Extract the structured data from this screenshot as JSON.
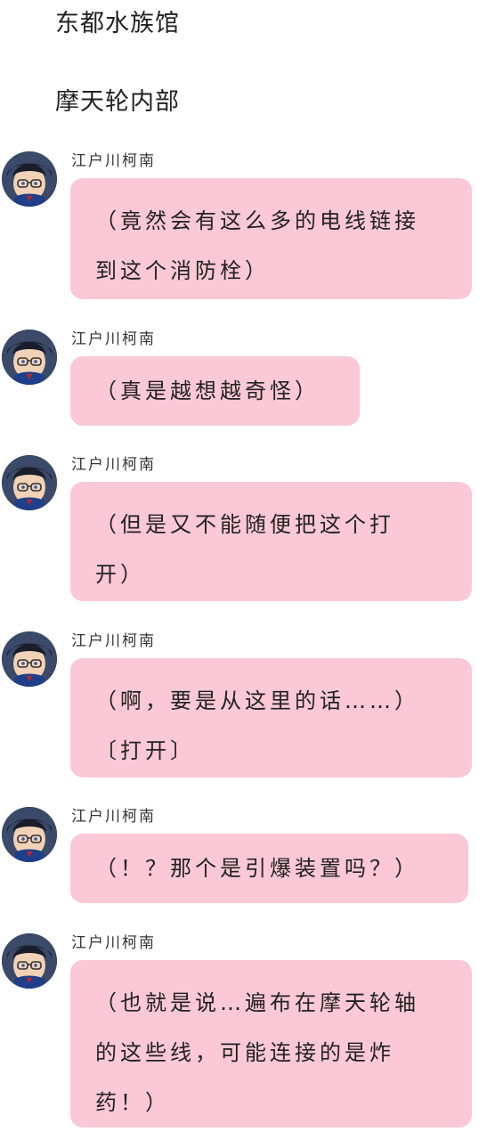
{
  "scene": {
    "location": "东都水族馆",
    "sublocation": "摩天轮内部"
  },
  "messages": [
    {
      "sender": "江户川柯南",
      "avatar_icon": "conan-avatar-icon",
      "text": "（竟然会有这么多的电线链接\n到这个消防栓）"
    },
    {
      "sender": "江户川柯南",
      "avatar_icon": "conan-avatar-icon",
      "text": "（真是越想越奇怪）"
    },
    {
      "sender": "江户川柯南",
      "avatar_icon": "conan-avatar-icon",
      "text": "（但是又不能随便把这个打\n开）"
    },
    {
      "sender": "江户川柯南",
      "avatar_icon": "conan-avatar-icon",
      "text": "（啊，要是从这里的话……）\n〔打开〕"
    },
    {
      "sender": "江户川柯南",
      "avatar_icon": "conan-avatar-icon",
      "text": "（！？那个是引爆装置吗？）"
    },
    {
      "sender": "江户川柯南",
      "avatar_icon": "conan-avatar-icon",
      "text": "（也就是说…遍布在摩天轮轴\n的这些线，可能连接的是炸\n药！）"
    }
  ],
  "colors": {
    "bubble": "#fac8d6",
    "background": "#ffffff",
    "text": "#222222"
  }
}
